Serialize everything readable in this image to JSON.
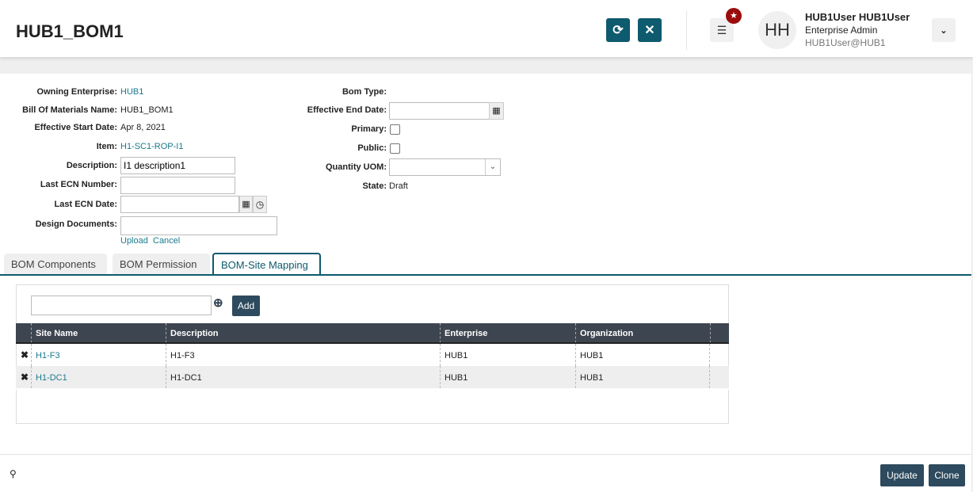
{
  "header": {
    "title": "HUB1_BOM1",
    "user_name": "HUB1User HUB1User",
    "user_role": "Enterprise Admin",
    "user_email": "HUB1User@HUB1",
    "avatar_initials": "HH"
  },
  "form": {
    "owning_enterprise": {
      "label": "Owning Enterprise:",
      "value": "HUB1"
    },
    "bom_name": {
      "label": "Bill Of Materials Name:",
      "value": "HUB1_BOM1"
    },
    "effective_start": {
      "label": "Effective Start Date:",
      "value": "Apr 8, 2021"
    },
    "item": {
      "label": "Item:",
      "value": "H1-SC1-ROP-I1"
    },
    "description": {
      "label": "Description:",
      "value": "I1 description1"
    },
    "last_ecn_number": {
      "label": "Last ECN Number:",
      "value": ""
    },
    "last_ecn_date": {
      "label": "Last ECN Date:",
      "value": ""
    },
    "design_documents": {
      "label": "Design Documents:",
      "upload": "Upload",
      "cancel": "Cancel"
    },
    "bom_type": {
      "label": "Bom Type:",
      "value": ""
    },
    "effective_end": {
      "label": "Effective End Date:",
      "value": ""
    },
    "primary": {
      "label": "Primary:",
      "checked": false
    },
    "public": {
      "label": "Public:",
      "checked": false
    },
    "quantity_uom": {
      "label": "Quantity UOM:",
      "value": ""
    },
    "state": {
      "label": "State:",
      "value": "Draft"
    }
  },
  "tabs": [
    {
      "label": "BOM Components"
    },
    {
      "label": "BOM Permission"
    },
    {
      "label": "BOM-Site Mapping",
      "active": true
    }
  ],
  "site_mapping": {
    "search_value": "",
    "add_label": "Add",
    "columns": [
      "Site Name",
      "Description",
      "Enterprise",
      "Organization"
    ],
    "rows": [
      [
        "H1-F3",
        "H1-F3",
        "HUB1",
        "HUB1"
      ],
      [
        "H1-DC1",
        "H1-DC1",
        "HUB1",
        "HUB1"
      ]
    ]
  },
  "footer": {
    "update_label": "Update",
    "clone_label": "Clone"
  },
  "colors": {
    "accent": "#0e5a6e",
    "link": "#1a7a8c",
    "badge": "#9b0c0c"
  }
}
